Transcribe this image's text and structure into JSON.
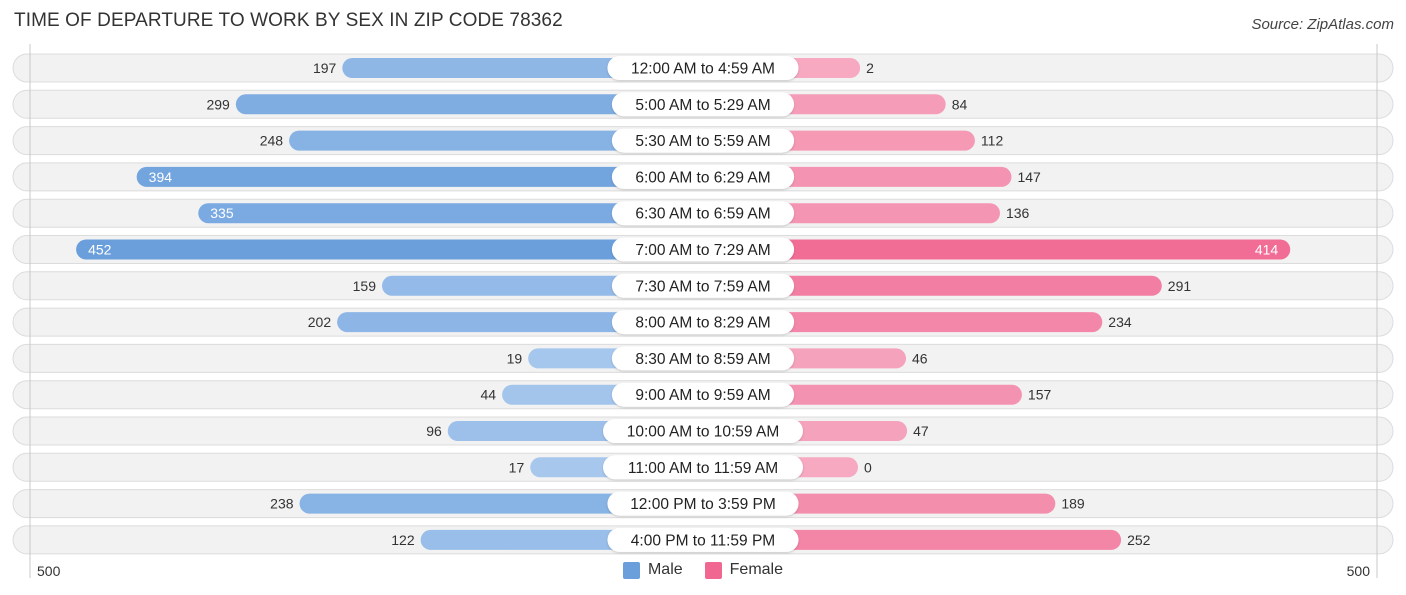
{
  "title": "TIME OF DEPARTURE TO WORK BY SEX IN ZIP CODE 78362",
  "source": "Source: ZipAtlas.com",
  "colors": {
    "male": "#6a9fdc",
    "male_light": "#a9c9ee",
    "female": "#f06892",
    "female_light": "#f6a9c1"
  },
  "chart_data": {
    "type": "bar",
    "orientation": "horizontal-diverging",
    "title": "TIME OF DEPARTURE TO WORK BY SEX IN ZIP CODE 78362",
    "categories": [
      "12:00 AM to 4:59 AM",
      "5:00 AM to 5:29 AM",
      "5:30 AM to 5:59 AM",
      "6:00 AM to 6:29 AM",
      "6:30 AM to 6:59 AM",
      "7:00 AM to 7:29 AM",
      "7:30 AM to 7:59 AM",
      "8:00 AM to 8:29 AM",
      "8:30 AM to 8:59 AM",
      "9:00 AM to 9:59 AM",
      "10:00 AM to 10:59 AM",
      "11:00 AM to 11:59 AM",
      "12:00 PM to 3:59 PM",
      "4:00 PM to 11:59 PM"
    ],
    "series": [
      {
        "name": "Male",
        "values": [
          197,
          299,
          248,
          394,
          335,
          452,
          159,
          202,
          19,
          44,
          96,
          17,
          238,
          122
        ]
      },
      {
        "name": "Female",
        "values": [
          2,
          84,
          112,
          147,
          136,
          414,
          291,
          234,
          46,
          157,
          47,
          0,
          189,
          252
        ]
      }
    ],
    "axis": {
      "left_label": "500",
      "right_label": "500",
      "range": [
        0,
        500
      ]
    },
    "legend": {
      "position": "bottom-center",
      "entries": [
        "Male",
        "Female"
      ]
    }
  }
}
